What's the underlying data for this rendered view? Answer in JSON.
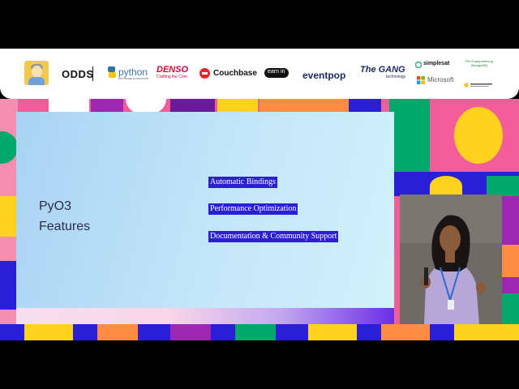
{
  "sponsors": {
    "odds": "ODDS",
    "python": "python",
    "python_sub": "SOFTWARE FOUNDATION",
    "denso": "DENSO",
    "denso_sub": "Crafting the Core",
    "couchbase": "Couchbase",
    "earnin": "earn in",
    "eventpop": "eventpop",
    "thegang": "The GANG",
    "thegang_sub": "technology",
    "simplesat": "simplesat",
    "microsoft": "Microsoft",
    "person_name": "Piti Champeethong",
    "person_sub": "(MongoDB)"
  },
  "slide": {
    "title_line1": "PyO3",
    "title_line2": "Features",
    "features": [
      "Automatic Bindings",
      "Performance Optimization",
      "Documentation & Community Support"
    ]
  },
  "colors": {
    "feature_highlight": "#2b1fd6",
    "python_blue": "#3572a5",
    "denso_red": "#dc0032",
    "couchbase_red": "#ea2328",
    "eventpop_navy": "#1a2a5e",
    "simplesat_green": "#2eb872"
  }
}
